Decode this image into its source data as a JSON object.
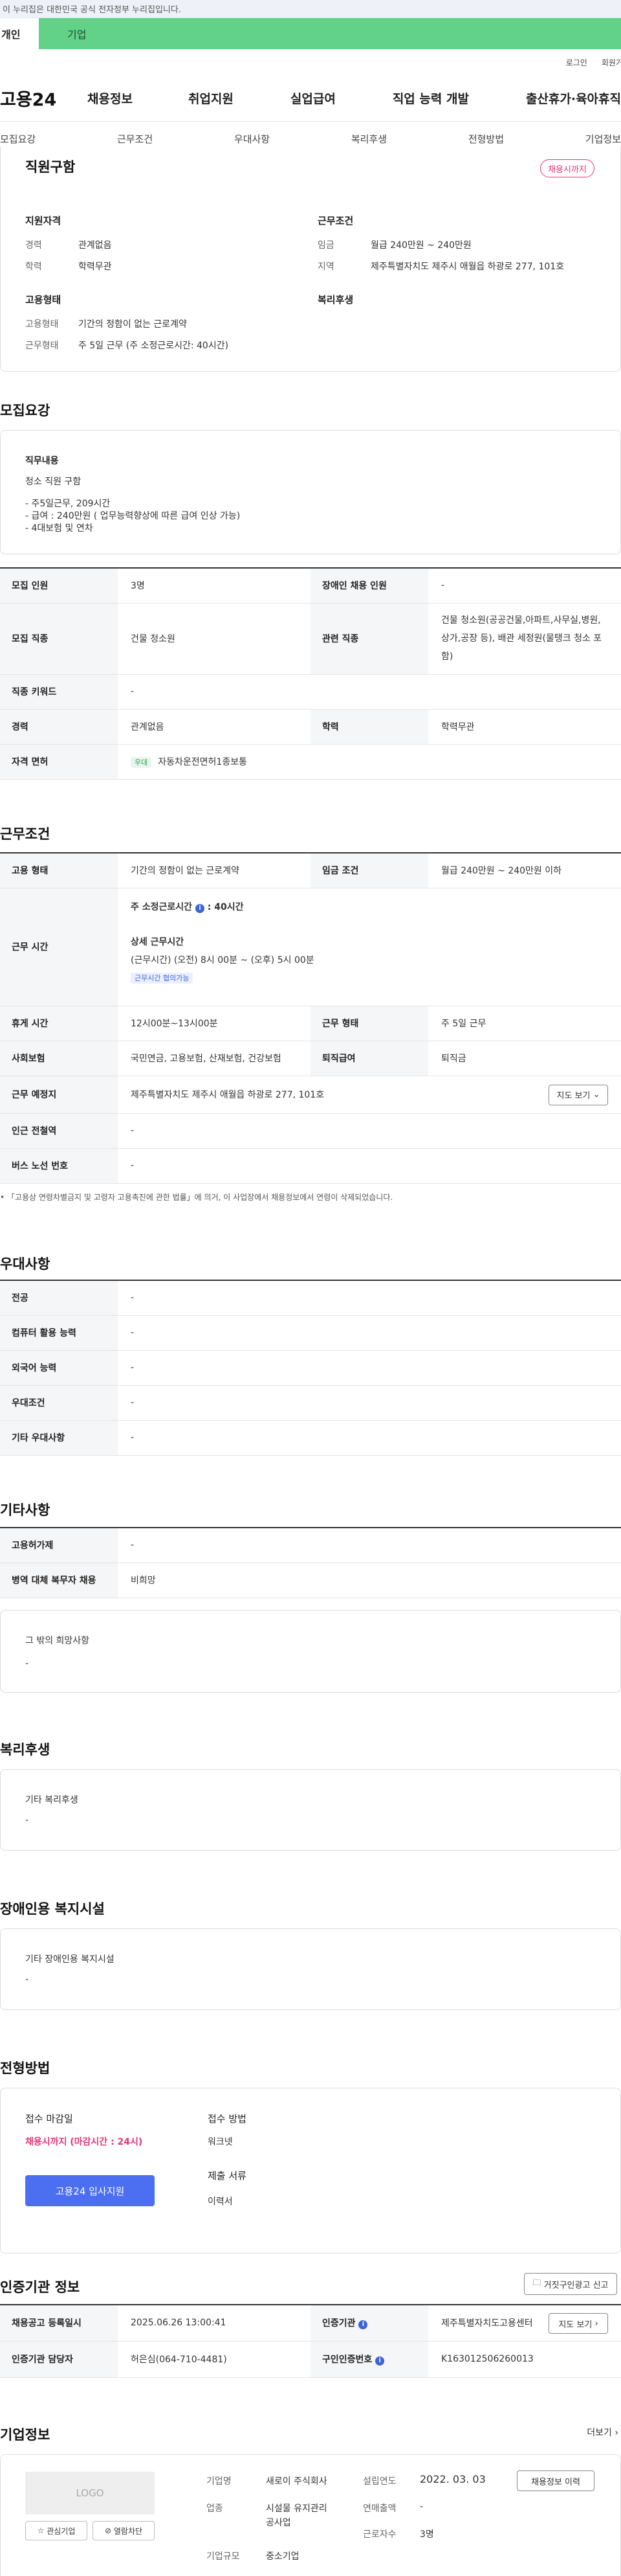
{
  "gov_banner": "이 누리집은 대한민국 공식 전자정부 누리집입니다.",
  "site_tabs": {
    "left": "개인",
    "right": "기업"
  },
  "util_links": [
    "로그인",
    "회원가입"
  ],
  "logo": "고용24",
  "main_nav": [
    "채용정보",
    "취업지원",
    "실업급여",
    "직업 능력 개발",
    "출산휴가·육아휴직"
  ],
  "sub_nav": [
    "모집요강",
    "근무조건",
    "우대사항",
    "복리후생",
    "전형방법",
    "기업정보"
  ],
  "summary": {
    "title": "직원구함",
    "badge": "채용시까지",
    "qualification": {
      "heading": "지원자격",
      "rows": [
        {
          "label": "경력",
          "value": "관계없음"
        },
        {
          "label": "학력",
          "value": "학력무관"
        }
      ]
    },
    "conditions": {
      "heading": "근무조건",
      "rows": [
        {
          "label": "임금",
          "value": "월급 240만원 ~ 240만원"
        },
        {
          "label": "지역",
          "value": "제주특별자치도 제주시 애월읍 하광로 277, 101호"
        }
      ]
    },
    "employment": {
      "heading": "고용형태",
      "rows": [
        {
          "label": "고용형태",
          "value": "기간의 정함이 없는 근로계약"
        },
        {
          "label": "근무형태",
          "value": "주 5일 근무 (주 소정근로시간: 40시간)"
        }
      ]
    },
    "welfare_heading": "복리후생"
  },
  "recruit": {
    "title": "모집요강",
    "duty_heading": "직무내용",
    "duty_title": "청소 직원 구함",
    "duty_lines": [
      "- 주5일근무, 209시간",
      "- 급여 : 240만원 ( 업무능력향상에 따른 급여 인상 가능)",
      "- 4대보험 및 연차"
    ],
    "rows": {
      "headcount_label": "모집 인원",
      "headcount": "3명",
      "disabled_label": "장애인 채용 인원",
      "disabled": "-",
      "job_label": "모집 직종",
      "job": "건물 청소원",
      "related_label": "관련 직종",
      "related": "건물 청소원(공공건물,아파트,사무실,병원,상가,공장 등), 배관 세정원(물탱크 청소 포함)",
      "keyword_label": "직종 키워드",
      "keyword": "-",
      "career_label": "경력",
      "career": "관계없음",
      "edu_label": "학력",
      "edu": "학력무관",
      "license_label": "자격 면허",
      "license_chip": "우대",
      "license": "자동차운전면허1종보통"
    }
  },
  "work": {
    "title": "근무조건",
    "type_label": "고용 형태",
    "type": "기간의 정함이 없는 근로계약",
    "wage_label": "임금 조건",
    "wage": "월급 240만원 ~ 240만원 이하",
    "hours_label": "근무 시간",
    "hours_weekly": "주 소정근로시간",
    "hours_weekly_val": ": 40시간",
    "hours_detail_heading": "상세 근무시간",
    "hours_detail": "(근무시간) (오전) 8시 00분 ~ (오후) 5시 00분",
    "hours_chip": "근무시간 협의가능",
    "break_label": "휴게 시간",
    "break": "12시00분~13시00분",
    "form_label": "근무 형태",
    "form": "주 5일 근무",
    "insurance_label": "사회보험",
    "insurance": "국민연금, 고용보험, 산재보험, 건강보험",
    "retire_label": "퇴직급여",
    "retire": "퇴직금",
    "place_label": "근무 예정지",
    "place": "제주특별자치도 제주시 애월읍 하광로 277, 101호",
    "map_btn": "지도 보기",
    "subway_label": "인근 전철역",
    "subway": "-",
    "bus_label": "버스 노선 번호",
    "bus": "-",
    "note": "「고용상 연령차별금지 및 고령자 고용촉진에 관한 법률」에 의거, 이 사업장에서 채용정보에서 연령이 삭제되었습니다."
  },
  "pref": {
    "title": "우대사항",
    "rows": [
      {
        "label": "전공",
        "value": "-"
      },
      {
        "label": "컴퓨터 활용 능력",
        "value": "-"
      },
      {
        "label": "외국어 능력",
        "value": "-"
      },
      {
        "label": "우대조건",
        "value": "-"
      },
      {
        "label": "기타 우대사항",
        "value": "-"
      }
    ]
  },
  "etc": {
    "title": "기타사항",
    "rows": [
      {
        "label": "고용허가제",
        "value": "-"
      },
      {
        "label": "병역 대체 복무자 채용",
        "value": "비희망"
      }
    ],
    "card_heading": "그 밖의 희망사항",
    "card_value": "-"
  },
  "welfare": {
    "title": "복리후생",
    "heading": "기타 복리후생",
    "value": "-"
  },
  "disability": {
    "title": "장애인용 복지시설",
    "heading": "기타 장애인용 복지시설",
    "value": "-"
  },
  "selection": {
    "title": "전형방법",
    "deadline_heading": "접수 마감일",
    "deadline": "채용시까지 (마감시간 : 24시)",
    "method_heading": "접수 방법",
    "method": "워크넷",
    "docs_heading": "제출 서류",
    "docs": "이력서",
    "apply_btn": "고용24 입사지원"
  },
  "agency": {
    "title": "인증기관 정보",
    "report_btn": "거짓구인광고 신고",
    "reg_label": "채용공고 등록일시",
    "reg": "2025.06.26 13:00:41",
    "agency_label": "인증기관",
    "agency": "제주특별자치도고용센터",
    "map_btn": "지도 보기",
    "manager_label": "인증기관 담당자",
    "manager": "허은심(064-710-4481)",
    "num_label": "구인인증번호",
    "num": "K163012506260013"
  },
  "company": {
    "title": "기업정보",
    "more": "더보기",
    "logo_text": "LOGO",
    "fav_btn": "관심기업",
    "block_btn": "열람차단",
    "name_label": "기업명",
    "name": "새로이 주식회사",
    "industry_label": "업종",
    "industry": "시설물 유지관리 공사업",
    "size_label": "기업규모",
    "size": "중소기업",
    "founded_label": "설립연도",
    "founded": "2022. 03. 03",
    "sales_label": "연매출액",
    "sales": "-",
    "staff_label": "근로자수",
    "staff": "3명",
    "history_btn": "채용정보 이력"
  },
  "colors": {
    "green": "#62d289",
    "pink": "#e0367a",
    "blue": "#4b6ff0"
  }
}
